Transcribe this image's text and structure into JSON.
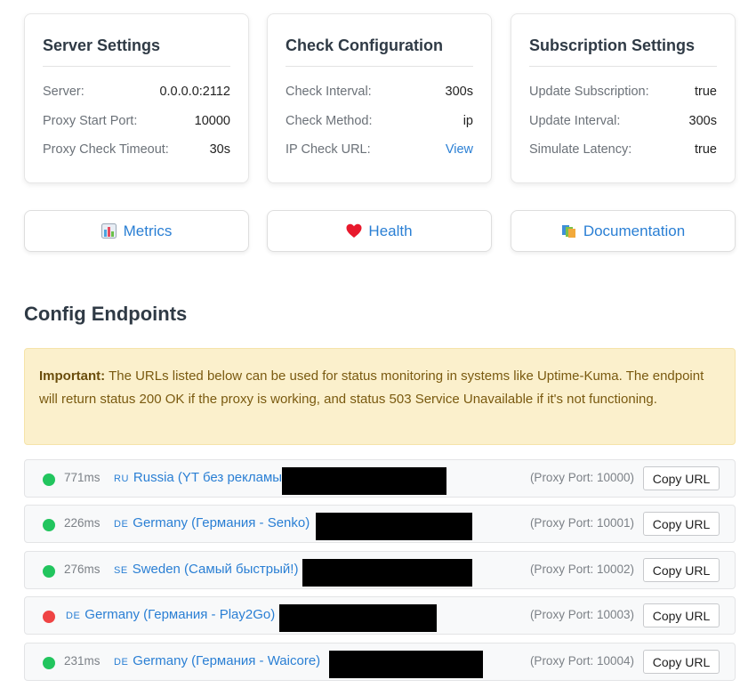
{
  "cards": [
    {
      "title": "Server Settings",
      "rows": [
        {
          "label": "Server:",
          "value": "0.0.0.0:2112"
        },
        {
          "label": "Proxy Start Port:",
          "value": "10000"
        },
        {
          "label": "Proxy Check Timeout:",
          "value": "30s"
        }
      ]
    },
    {
      "title": "Check Configuration",
      "rows": [
        {
          "label": "Check Interval:",
          "value": "300s"
        },
        {
          "label": "Check Method:",
          "value": "ip"
        },
        {
          "label": "IP Check URL:",
          "value": "View"
        }
      ]
    },
    {
      "title": "Subscription Settings",
      "rows": [
        {
          "label": "Update Subscription:",
          "value": "true"
        },
        {
          "label": "Update Interval:",
          "value": "300s"
        },
        {
          "label": "Simulate Latency:",
          "value": "true"
        }
      ]
    }
  ],
  "links": [
    {
      "label": "Metrics",
      "icon": "bar-chart-icon"
    },
    {
      "label": "Health",
      "icon": "heart-icon"
    },
    {
      "label": "Documentation",
      "icon": "books-icon"
    }
  ],
  "section_title": "Config Endpoints",
  "notice": {
    "bold": "Important:",
    "text": " The URLs listed below can be used for status monitoring in systems like Uptime-Kuma. The endpoint will return status 200 OK if the proxy is working, and status 503 Service Unavailable if it's not functioning."
  },
  "endpoints": [
    {
      "status_color": "#22c55e",
      "latency": "771ms",
      "flag": "RU",
      "name": "Russia (YT без рекламы",
      "port": "(Proxy Port: 10000)",
      "copy_label": "Copy URL"
    },
    {
      "status_color": "#22c55e",
      "latency": "226ms",
      "flag": "DE",
      "name": "Germany (Германия - Senko)",
      "port": "(Proxy Port: 10001)",
      "copy_label": "Copy URL"
    },
    {
      "status_color": "#22c55e",
      "latency": "276ms",
      "flag": "SE",
      "name": "Sweden (Самый быстрый!)",
      "port": "(Proxy Port: 10002)",
      "copy_label": "Copy URL"
    },
    {
      "status_color": "#ef4444",
      "latency": "",
      "flag": "DE",
      "name": "Germany (Германия - Play2Go)",
      "port": "(Proxy Port: 10003)",
      "copy_label": "Copy URL"
    },
    {
      "status_color": "#22c55e",
      "latency": "231ms",
      "flag": "DE",
      "name": "Germany (Германия - Waicore)",
      "port": "(Proxy Port: 10004)",
      "copy_label": "Copy URL"
    }
  ]
}
